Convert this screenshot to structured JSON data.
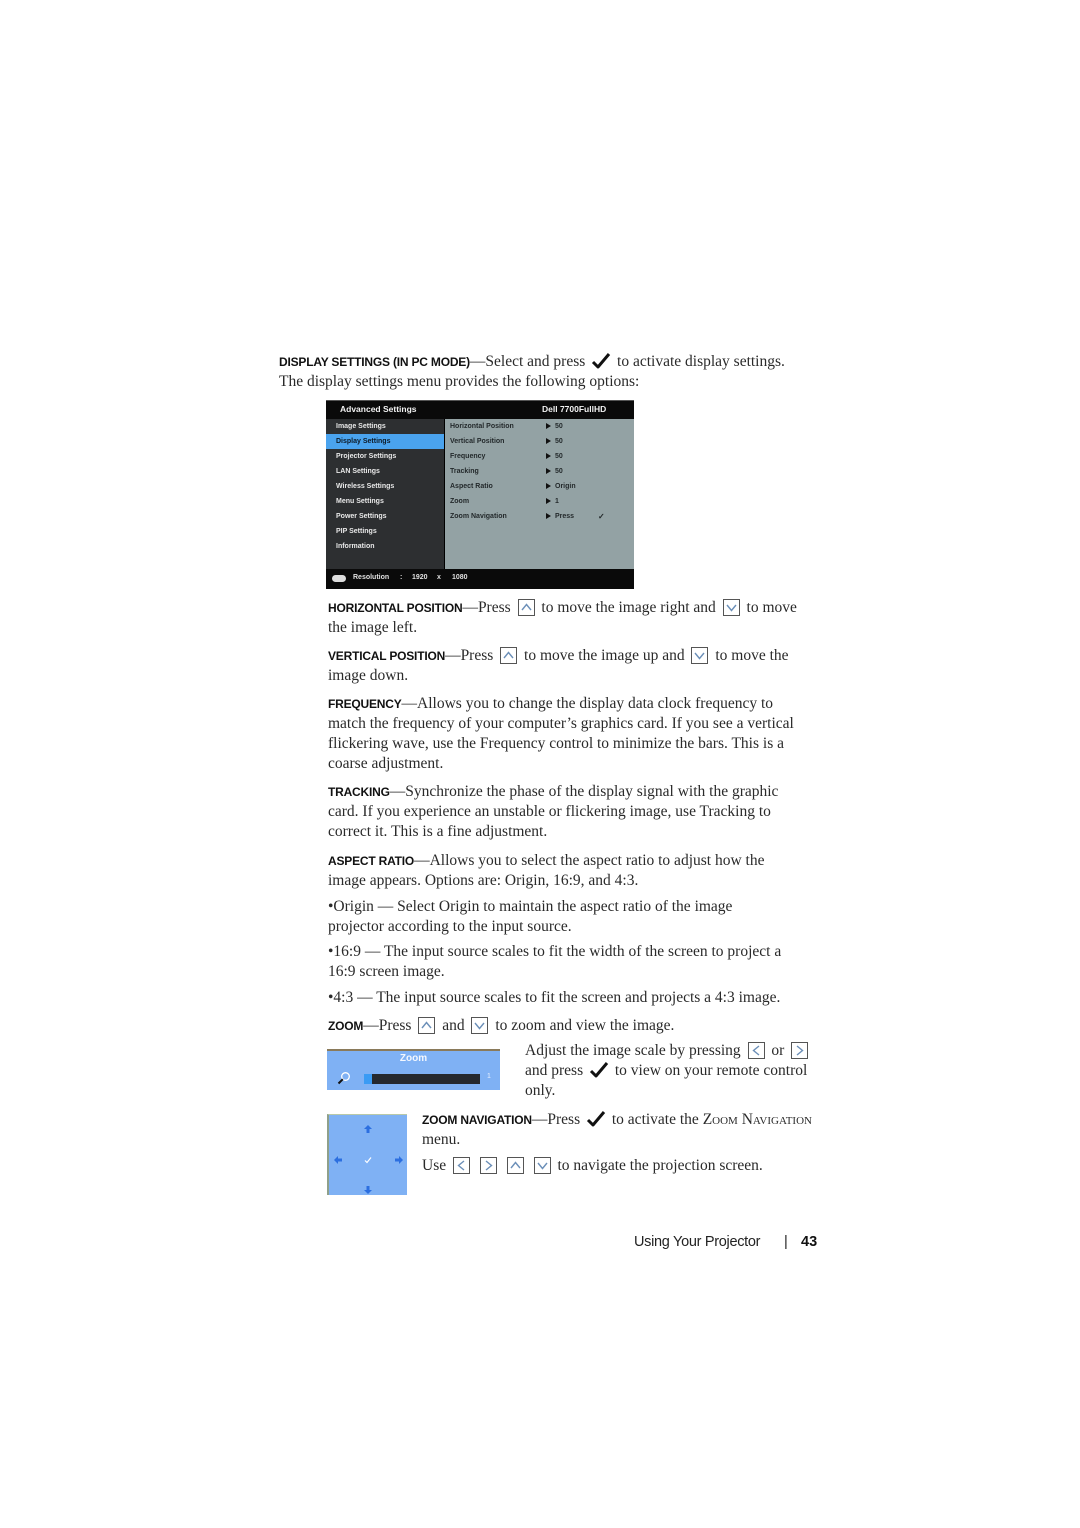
{
  "intro": {
    "heading_parts": [
      "D",
      "ISPLAY ",
      "S",
      "ETTINGS (IN ",
      "PC M",
      "ODE)"
    ],
    "heading": "Display Settings (in PC Mode)",
    "lead": "—Select and press",
    "lead_after": "to activate display settings.",
    "line2": "The display settings menu provides the following options:"
  },
  "osd": {
    "title": "Advanced Settings",
    "model": "Dell 7700FullHD",
    "menu_items": [
      {
        "label": "Image Settings",
        "selected": false
      },
      {
        "label": "Display Settings",
        "selected": true
      },
      {
        "label": "Projector Settings",
        "selected": false
      },
      {
        "label": "LAN Settings",
        "selected": false
      },
      {
        "label": "Wireless Settings",
        "selected": false
      },
      {
        "label": "Menu Settings",
        "selected": false
      },
      {
        "label": "Power Settings",
        "selected": false
      },
      {
        "label": "PIP Settings",
        "selected": false
      },
      {
        "label": "Information",
        "selected": false
      }
    ],
    "options": [
      {
        "label": "Horizontal Position",
        "value": "50"
      },
      {
        "label": "Vertical Position",
        "value": "50"
      },
      {
        "label": "Frequency",
        "value": "50"
      },
      {
        "label": "Tracking",
        "value": "50"
      },
      {
        "label": "Aspect Ratio",
        "value": "Origin"
      },
      {
        "label": "Zoom",
        "value": "1"
      },
      {
        "label": "Zoom Navigation",
        "value": "Press",
        "check": "✓"
      }
    ],
    "footer": {
      "icon": "input-source-icon",
      "label": "Resolution",
      "colon": ":",
      "width": "1920",
      "x": "x",
      "height": "1080"
    }
  },
  "sections": {
    "horizontal": {
      "heading": "Horizontal Position",
      "t1": "—Press",
      "t2": "to move the image right and",
      "t3": "to move",
      "t4": "the image left."
    },
    "vertical": {
      "heading": "Vertical Position",
      "t1": "—Press",
      "t2": "to move the image up and",
      "t3": "to move the",
      "t4": "image down."
    },
    "frequency": {
      "heading": "Frequency",
      "l1": "—Allows you to change the display data clock frequency to",
      "l2": "match the frequency of your computer’s graphics card. If you see a vertical",
      "l3": "flickering wave, use the Frequency control to minimize the bars. This is a",
      "l4": "coarse adjustment."
    },
    "tracking": {
      "heading": "Tracking",
      "l1": "—Synchronize the phase of the display signal with the graphic",
      "l2": "card. If you experience an unstable or flickering image, use Tracking to",
      "l3": "correct it. This is a fine adjustment."
    },
    "aspect": {
      "heading": "Aspect Ratio",
      "l1": "—Allows you to select the aspect ratio to adjust how the",
      "l2": "image appears. Options are: Origin, 16:9, and 4:3.",
      "b1l1": "•Origin — Select Origin to maintain the aspect ratio of the image",
      "b1l2": "projector according to the input source.",
      "b2l1": "•16:9 — The input source scales to fit the width of the screen to project a",
      "b2l2": "16:9 screen image.",
      "b3": "•4:3 — The input source scales to fit the screen and projects a 4:3 image."
    },
    "zoom": {
      "heading": "Zoom",
      "t1": "—Press",
      "t2": "and",
      "t3": "to zoom and view the image.",
      "side_l1": "Adjust the image scale by pressing",
      "side_or": "or",
      "side_l2a": "and press",
      "side_l2b": "to view on your remote control",
      "side_l3": "only.",
      "widget_title": "Zoom",
      "widget_value": "1",
      "widget_level": 0.07
    },
    "zoom_nav": {
      "heading": "Zoom Navigation",
      "t1": "—Press",
      "t2": "to activate the",
      "t3": "Zoom Navigation",
      "t4": "menu.",
      "use": "Use",
      "use_after": "to navigate the projection screen."
    }
  },
  "footer": {
    "label": "Using Your Projector",
    "separator": "|",
    "page": "43"
  }
}
